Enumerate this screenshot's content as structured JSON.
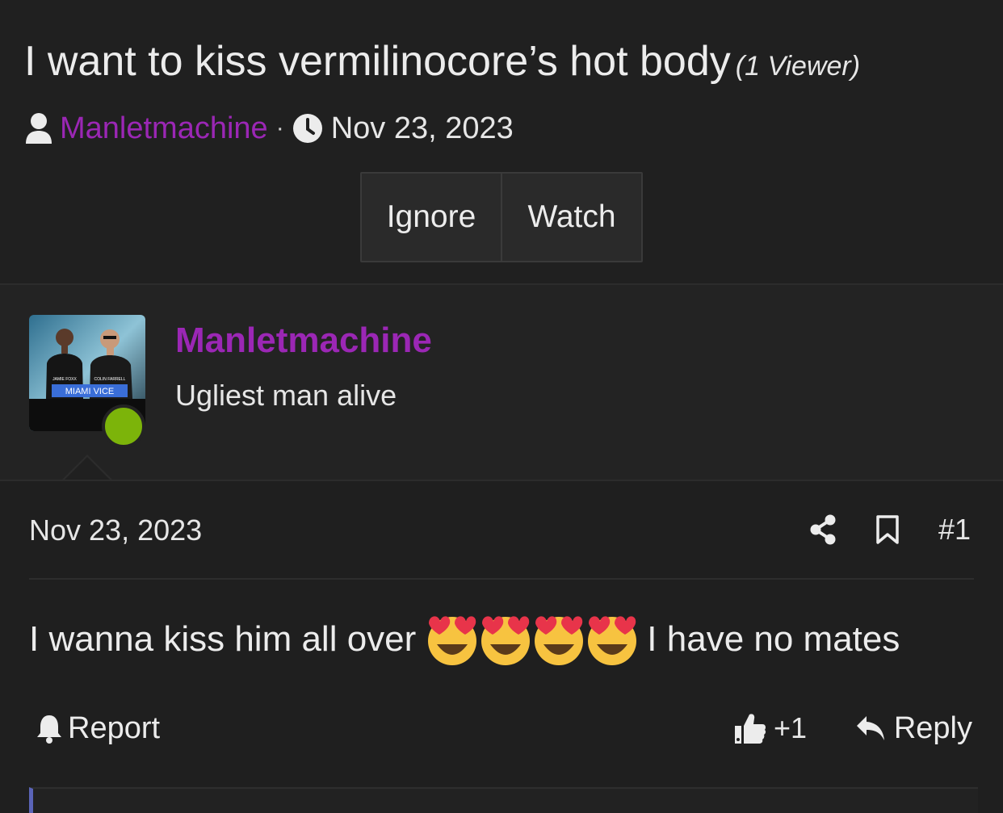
{
  "thread": {
    "title": "I want to kiss vermilinocore’s hot body",
    "viewers": "(1 Viewer)",
    "author": "Manletmachine",
    "separator": "·",
    "date": "Nov 23, 2023"
  },
  "buttons": {
    "ignore": "Ignore",
    "watch": "Watch"
  },
  "post": {
    "user": {
      "name": "Manletmachine",
      "title": "Ugliest man alive",
      "avatar_caption": "MIAMI VICE",
      "avatar_names": [
        "JAMIE FOXX",
        "COLIN FARRELL"
      ],
      "online_color": "#7cb40a"
    },
    "date": "Nov 23, 2023",
    "number": "#1",
    "text_before": "I wanna kiss him all over",
    "emoji_count": 4,
    "emoji_name": "heart-eyes-emoji",
    "text_after": "I have no mates",
    "actions": {
      "report": "Report",
      "react_count": "+1",
      "reply": "Reply"
    }
  },
  "colors": {
    "username": "#9b27b5",
    "background": "#1f1f1f",
    "accent_bar": "#5a64b8"
  }
}
